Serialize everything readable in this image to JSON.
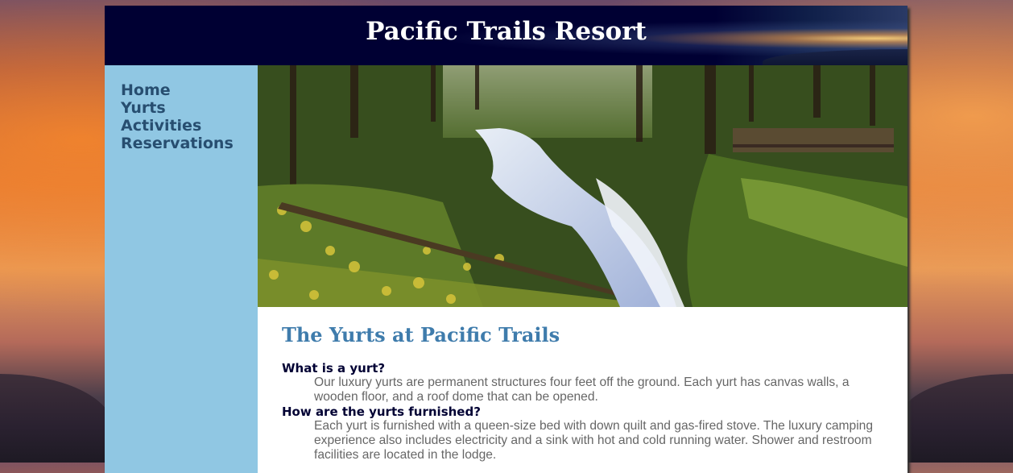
{
  "header": {
    "title": "Pacific Trails Resort"
  },
  "nav": {
    "items": [
      {
        "label": "Home"
      },
      {
        "label": "Yurts"
      },
      {
        "label": "Activities"
      },
      {
        "label": "Reservations"
      }
    ]
  },
  "main": {
    "heading": "The Yurts at Pacific Trails",
    "faq": [
      {
        "question": "What is a yurt?",
        "answer": "Our luxury yurts are permanent structures four feet off the ground. Each yurt has canvas walls, a wooden floor, and a roof dome that can be opened."
      },
      {
        "question": "How are the yurts furnished?",
        "answer": "Each yurt is furnished with a queen-size bed with down quilt and gas-fired stove. The luxury camping experience also includes electricity and a sink with hot and cold running water. Shower and restroom facilities are located in the lodge."
      }
    ]
  },
  "colors": {
    "header_bg": "#000033",
    "nav_bg": "#90c7e3",
    "nav_link": "#274e70",
    "heading": "#3f7cac",
    "dt": "#000033",
    "dd": "#666666"
  }
}
